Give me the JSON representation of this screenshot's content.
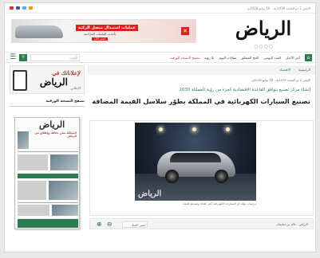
{
  "topbar": {
    "date": "الإثنين 2 ذو القعدة 1439 هـ - 16 يوليو 2018م"
  },
  "ad": {
    "title": "عمليات استبدال متصل الركبة",
    "subtitle": "بأحدث التقنيات الجراحية",
    "cta": "احجز الآن"
  },
  "logo": {
    "text": "الرياض"
  },
  "nav": {
    "items": [
      "آخر الأخبار",
      "العدد اليومي",
      "الحج المتعلق",
      "مقالات اليوم",
      "بلا رؤية",
      "تصفح النسخة الورقية"
    ],
    "search_placeholder": "البحث"
  },
  "sidebar": {
    "ad_line1": "لإعلاناتك في",
    "ad_line2": "الرياض",
    "ad_line3": "الإعلاني",
    "section_title": "تصفح النسخة الورقية",
    "paper_masthead": "الرياض",
    "paper_headline": "المملكة تعلن تحالف وإطلاق في الرياض"
  },
  "article": {
    "crumbs": [
      "الرئيسية",
      "الاقتصاد"
    ],
    "meta": "الإثنين 2 ذو القعدة 1439هـ - 16 يوليو 2018م",
    "kicker": "إنشاء مركز تصنيع يتوافق القاعدة الاقتصادية كجزء من رؤية المملكة 2030",
    "headline": "تصنيع السيارات الكهربائية في المملكة يطوّر سلاسل القيمة المضافة",
    "photo_watermark": "الرياض",
    "caption": "دراسات تؤكد أن السيارات الكهربائية أكثر كفاءة وصديقة للبيئة"
  },
  "tools": {
    "zoom_in": "⊕",
    "zoom_out": "⊖",
    "size_label": "تغيير الخط",
    "author": "الرياض - خالد بن سليمان"
  },
  "colors": {
    "brand_green": "#2a7b4f",
    "ad_red": "#d9231d"
  }
}
